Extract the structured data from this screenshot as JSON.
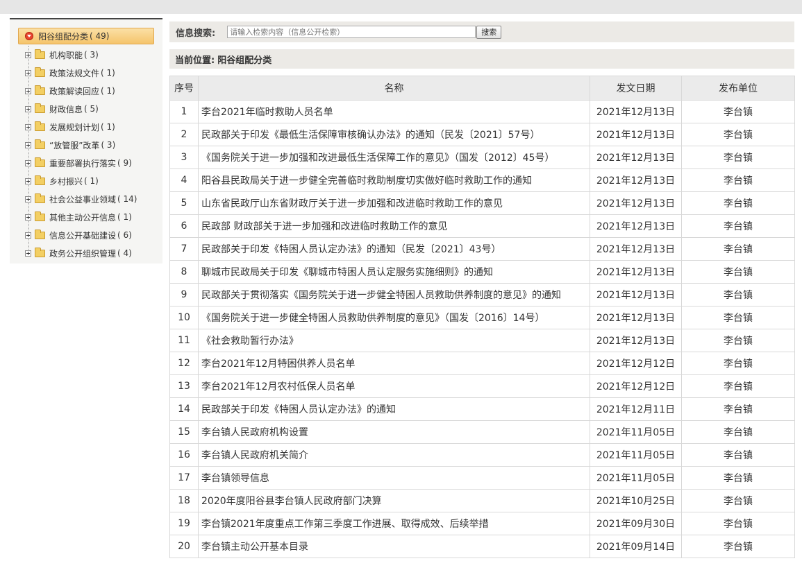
{
  "sidebar": {
    "root": {
      "label": "阳谷组配分类",
      "count": "( 49)"
    },
    "items": [
      {
        "label": "机构职能",
        "count": "( 3)"
      },
      {
        "label": "政策法规文件",
        "count": "( 1)"
      },
      {
        "label": "政策解读回应",
        "count": "( 1)"
      },
      {
        "label": "财政信息",
        "count": "( 5)"
      },
      {
        "label": "发展规划计划",
        "count": "( 1)"
      },
      {
        "label": "“放管服”改革",
        "count": "( 3)"
      },
      {
        "label": "重要部署执行落实",
        "count": "( 9)"
      },
      {
        "label": "乡村振兴",
        "count": "( 1)"
      },
      {
        "label": "社会公益事业领域",
        "count": "( 14)"
      },
      {
        "label": "其他主动公开信息",
        "count": "( 1)"
      },
      {
        "label": "信息公开基础建设",
        "count": "( 6)"
      },
      {
        "label": "政务公开组织管理",
        "count": "( 4)"
      }
    ],
    "icons": {
      "root": "collapse-arrow-icon",
      "expand": "plus-box-icon",
      "folder": "folder-icon"
    }
  },
  "search": {
    "label": "信息搜索:",
    "placeholder": "请输入检索内容（信息公开检索）",
    "button": "搜索"
  },
  "breadcrumb": {
    "prefix": "当前位置:",
    "current": "阳谷组配分类"
  },
  "table": {
    "headers": {
      "idx": "序号",
      "name": "名称",
      "date": "发文日期",
      "unit": "发布单位"
    },
    "rows": [
      {
        "idx": "1",
        "name": "李台2021年临时救助人员名单",
        "date": "2021年12月13日",
        "unit": "李台镇"
      },
      {
        "idx": "2",
        "name": "民政部关于印发《最低生活保障审核确认办法》的通知（民发〔2021〕57号）",
        "date": "2021年12月13日",
        "unit": "李台镇"
      },
      {
        "idx": "3",
        "name": "《国务院关于进一步加强和改进最低生活保障工作的意见》（国发〔2012〕45号）",
        "date": "2021年12月13日",
        "unit": "李台镇"
      },
      {
        "idx": "4",
        "name": "阳谷县民政局关于进一步健全完善临时救助制度切实做好临时救助工作的通知",
        "date": "2021年12月13日",
        "unit": "李台镇"
      },
      {
        "idx": "5",
        "name": "山东省民政厅山东省财政厅关于进一步加强和改进临时救助工作的意见",
        "date": "2021年12月13日",
        "unit": "李台镇"
      },
      {
        "idx": "6",
        "name": "民政部 财政部关于进一步加强和改进临时救助工作的意见",
        "date": "2021年12月13日",
        "unit": "李台镇"
      },
      {
        "idx": "7",
        "name": "民政部关于印发《特困人员认定办法》的通知（民发〔2021〕43号）",
        "date": "2021年12月13日",
        "unit": "李台镇"
      },
      {
        "idx": "8",
        "name": "聊城市民政局关于印发《聊城市特困人员认定服务实施细则》的通知",
        "date": "2021年12月13日",
        "unit": "李台镇"
      },
      {
        "idx": "9",
        "name": "民政部关于贯彻落实《国务院关于进一步健全特困人员救助供养制度的意见》的通知",
        "date": "2021年12月13日",
        "unit": "李台镇"
      },
      {
        "idx": "10",
        "name": "《国务院关于进一步健全特困人员救助供养制度的意见》（国发〔2016〕14号）",
        "date": "2021年12月13日",
        "unit": "李台镇"
      },
      {
        "idx": "11",
        "name": "《社会救助暂行办法》",
        "date": "2021年12月13日",
        "unit": "李台镇"
      },
      {
        "idx": "12",
        "name": "李台2021年12月特困供养人员名单",
        "date": "2021年12月12日",
        "unit": "李台镇"
      },
      {
        "idx": "13",
        "name": "李台2021年12月农村低保人员名单",
        "date": "2021年12月12日",
        "unit": "李台镇"
      },
      {
        "idx": "14",
        "name": "民政部关于印发《特困人员认定办法》的通知",
        "date": "2021年12月11日",
        "unit": "李台镇"
      },
      {
        "idx": "15",
        "name": "李台镇人民政府机构设置",
        "date": "2021年11月05日",
        "unit": "李台镇"
      },
      {
        "idx": "16",
        "name": "李台镇人民政府机关简介",
        "date": "2021年11月05日",
        "unit": "李台镇"
      },
      {
        "idx": "17",
        "name": "李台镇领导信息",
        "date": "2021年11月05日",
        "unit": "李台镇"
      },
      {
        "idx": "18",
        "name": "2020年度阳谷县李台镇人民政府部门决算",
        "date": "2021年10月25日",
        "unit": "李台镇"
      },
      {
        "idx": "19",
        "name": "李台镇2021年度重点工作第三季度工作进展、取得成效、后续举措",
        "date": "2021年09月30日",
        "unit": "李台镇"
      },
      {
        "idx": "20",
        "name": "李台镇主动公开基本目录",
        "date": "2021年09月14日",
        "unit": "李台镇"
      }
    ]
  }
}
